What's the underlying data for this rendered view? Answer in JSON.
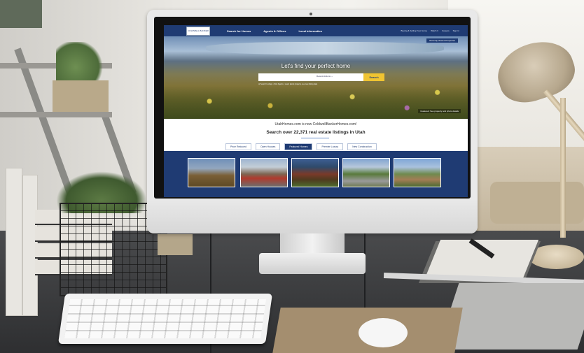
{
  "website": {
    "nav": {
      "logo_text": "COLDWELL BANKER",
      "links": [
        "Search for Homes",
        "Agents & Offices",
        "Local Information"
      ],
      "right_links": [
        "Buying & Selling Your Home",
        "Watch It",
        "Careers",
        "Sign In"
      ]
    },
    "hero": {
      "corner_button": "Recently Viewed Properties",
      "title": "Let's find your perfect home",
      "search_select": "Recent Actions ⌄",
      "search_button": "Search",
      "subtext": "or Search Listings • Find Agents • Learn about property, see new listing data",
      "photo_credit": "Featured: See property and photo details"
    },
    "info": {
      "line1": "UtahHomes.com is now ColdwellBankerHomes.com!",
      "line2": "Search over 22,371 real estate listings in Utah"
    },
    "tabs": [
      "Price Reduced",
      "Open Houses",
      "Featured Homes",
      "Premier Luxury",
      "New Construction"
    ],
    "active_tab": "Featured Homes",
    "photo_count": 5
  },
  "colors": {
    "brand_navy": "#1f3b73",
    "search_button_yellow": "#f0c431"
  }
}
